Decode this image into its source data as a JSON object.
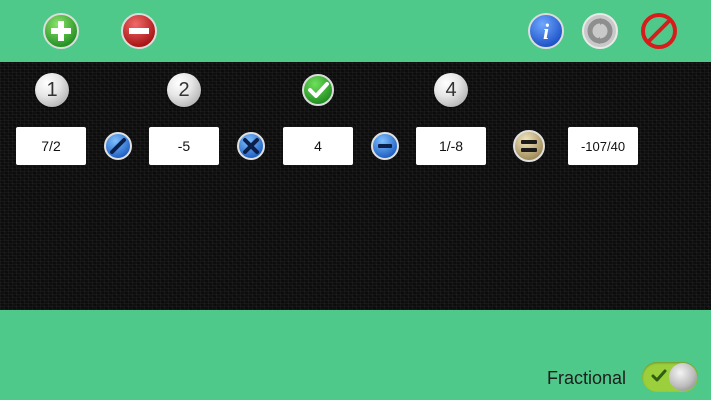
{
  "toolbar": {
    "add_icon": "plus-circle-green",
    "remove_icon": "minus-circle-red",
    "info_icon": "info-circle-blue",
    "refresh_icon": "refresh-circle-gray",
    "cancel_icon": "no-entry-red"
  },
  "steps": [
    {
      "label": "1",
      "state": "number"
    },
    {
      "label": "2",
      "state": "number"
    },
    {
      "label": "",
      "state": "done"
    },
    {
      "label": "4",
      "state": "number"
    }
  ],
  "expression": {
    "operand1": "7/2",
    "op1": "divide",
    "operand2": "-5",
    "op2": "multiply",
    "operand3": "4",
    "op3": "subtract",
    "operand4": "1/-8",
    "equals": "equals",
    "result": "-107/40"
  },
  "toggle": {
    "label": "Fractional",
    "checked": true
  },
  "colors": {
    "background": "#4fc98a",
    "board": "#0f0f0f",
    "toggle_on": "#9ccf3c"
  }
}
